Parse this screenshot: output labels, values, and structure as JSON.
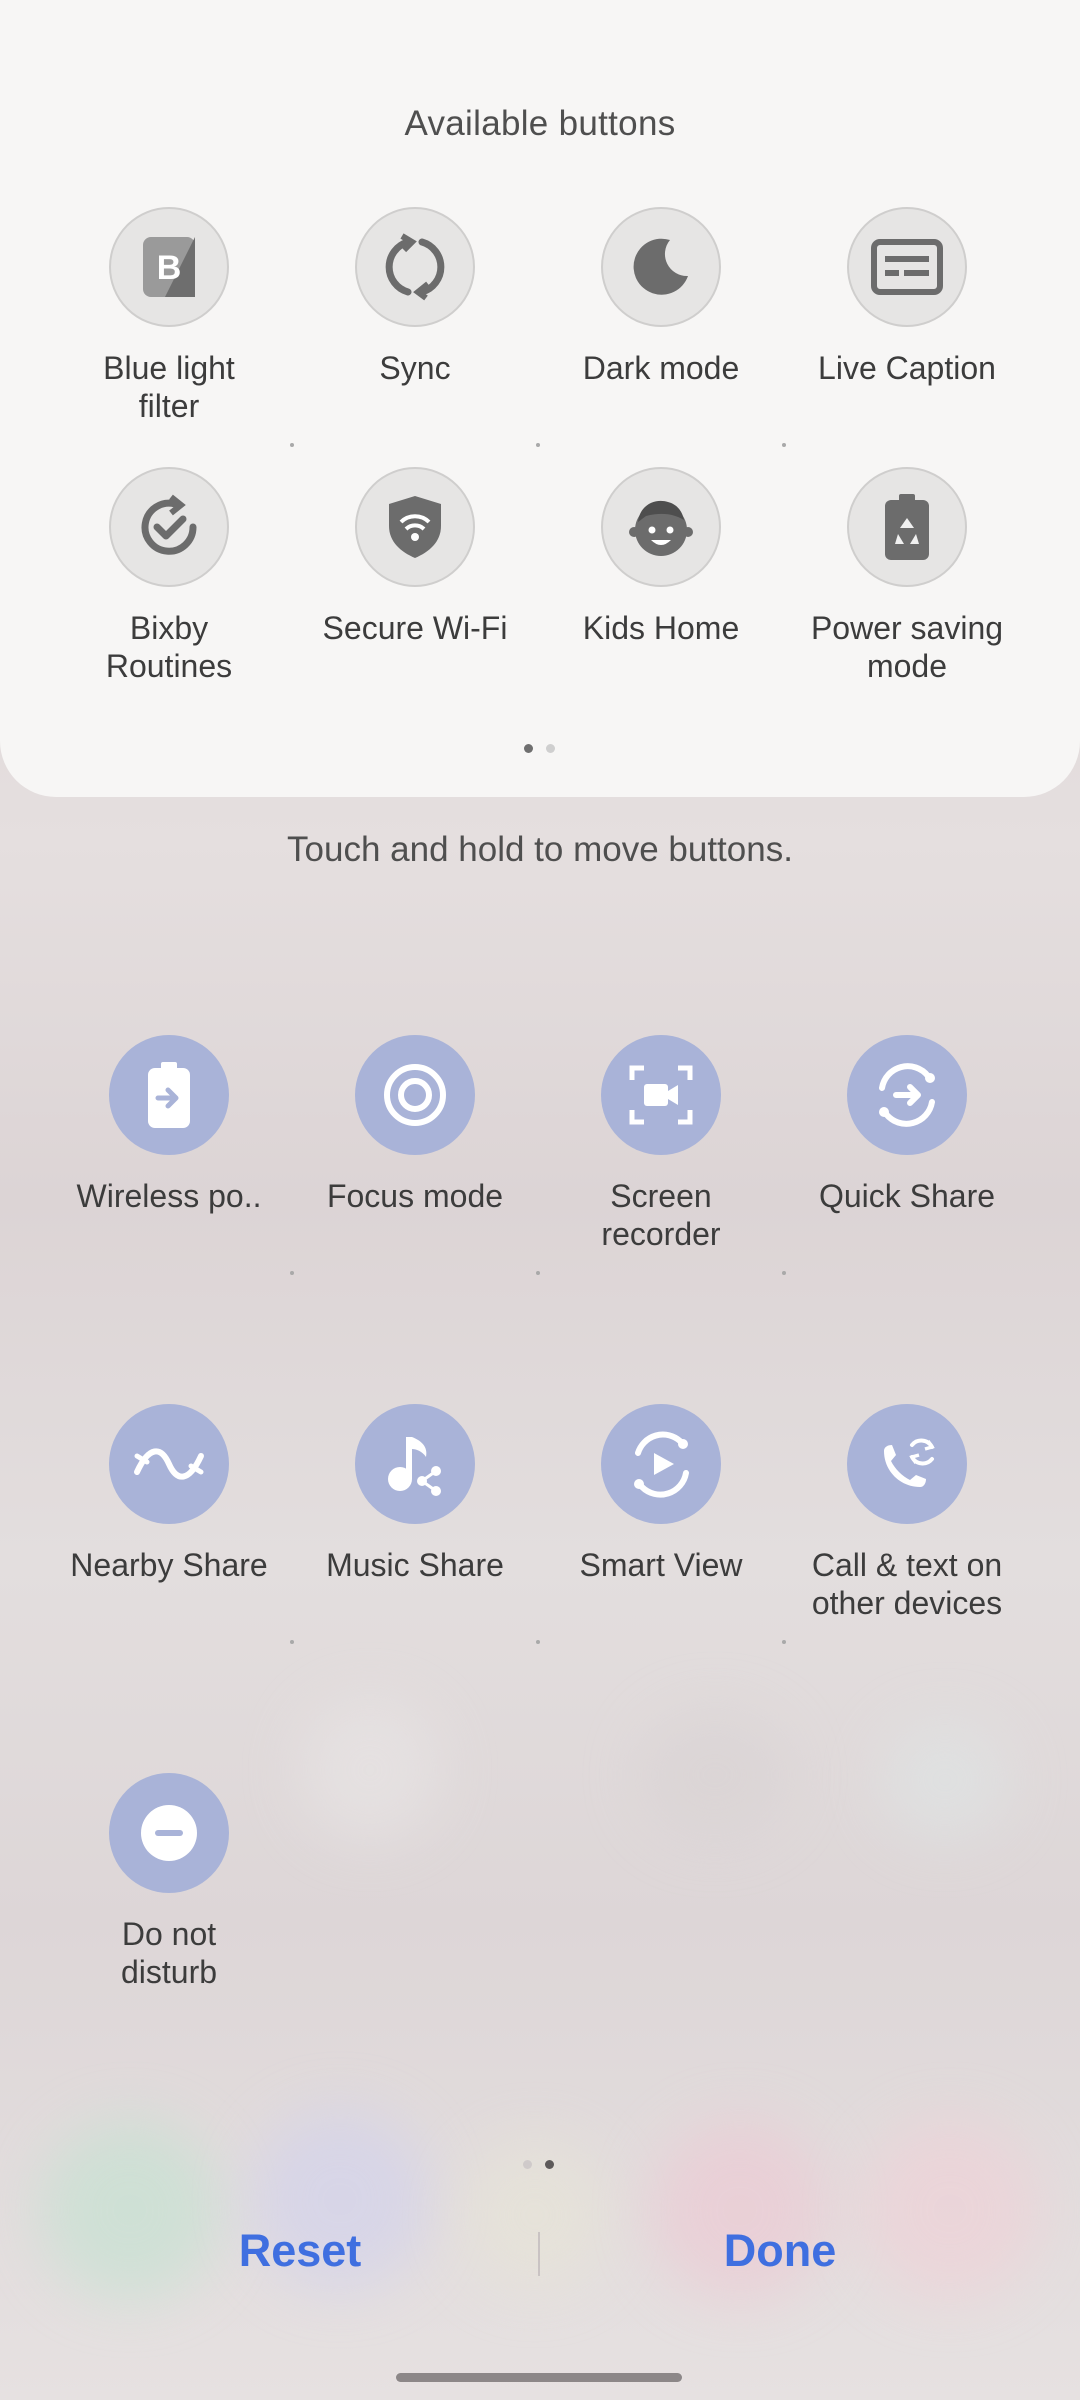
{
  "available": {
    "title": "Available buttons",
    "buttons": [
      {
        "label": "Blue light\nfilter",
        "icon": "blue-light-filter-icon"
      },
      {
        "label": "Sync",
        "icon": "sync-icon"
      },
      {
        "label": "Dark mode",
        "icon": "moon-icon"
      },
      {
        "label": "Live Caption",
        "icon": "caption-icon"
      },
      {
        "label": "Bixby\nRoutines",
        "icon": "routines-icon"
      },
      {
        "label": "Secure Wi-Fi",
        "icon": "secure-wifi-icon"
      },
      {
        "label": "Kids Home",
        "icon": "kids-face-icon"
      },
      {
        "label": "Power saving\nmode",
        "icon": "power-saving-icon"
      }
    ],
    "page_count": 2,
    "current_page": 1
  },
  "hint": "Touch and hold to move buttons.",
  "active": {
    "buttons": [
      {
        "label": "Wireless po..",
        "icon": "wireless-powershare-icon"
      },
      {
        "label": "Focus mode",
        "icon": "focus-icon"
      },
      {
        "label": "Screen\nrecorder",
        "icon": "screen-recorder-icon"
      },
      {
        "label": "Quick Share",
        "icon": "quick-share-icon"
      },
      {
        "label": "Nearby Share",
        "icon": "nearby-share-icon"
      },
      {
        "label": "Music Share",
        "icon": "music-share-icon"
      },
      {
        "label": "Smart View",
        "icon": "smart-view-icon"
      },
      {
        "label": "Call & text on\nother devices",
        "icon": "call-text-icon"
      },
      {
        "label": "Do not\ndisturb",
        "icon": "do-not-disturb-icon"
      }
    ],
    "page_count": 2,
    "current_page": 2
  },
  "actions": {
    "reset": "Reset",
    "done": "Done"
  },
  "colors": {
    "accent": "#3f6fe0",
    "active_circle": "#a9b3d8",
    "inactive_circle": "#e6e5e4"
  }
}
